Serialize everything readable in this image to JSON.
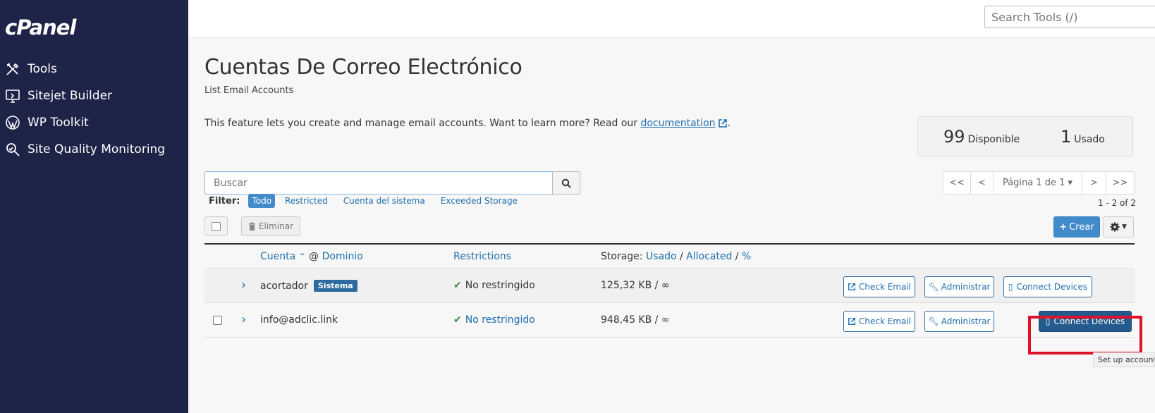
{
  "sidebar": {
    "logo": "cPanel",
    "items": [
      {
        "label": "Tools",
        "icon": "tools-icon"
      },
      {
        "label": "Sitejet Builder",
        "icon": "monitor-icon"
      },
      {
        "label": "WP Toolkit",
        "icon": "wordpress-icon"
      },
      {
        "label": "Site Quality Monitoring",
        "icon": "magnifier-icon"
      }
    ]
  },
  "topbar": {
    "search_placeholder": "Search Tools (/)"
  },
  "page": {
    "title": "Cuentas De Correo Electrónico",
    "subtitle": "List Email Accounts",
    "description": "This feature lets you create and manage email accounts. Want to learn more? Read our ",
    "doc_link": "documentation",
    "description_end": "."
  },
  "stats": {
    "available_num": "99",
    "available_label": "Disponible",
    "used_num": "1",
    "used_label": "Usado"
  },
  "search": {
    "placeholder": "Buscar"
  },
  "pager": {
    "first": "<<",
    "prev": "<",
    "page": "Página 1 de 1",
    "next": ">",
    "last": ">>",
    "count": "1 - 2 of 2"
  },
  "filters": {
    "label": "Filter:",
    "items": [
      "Todo",
      "Restricted",
      "Cuenta del sistema",
      "Exceeded Storage"
    ]
  },
  "toolbar": {
    "delete": "Eliminar",
    "create": "Crear"
  },
  "table": {
    "headers": {
      "account": "Cuenta",
      "at": "@",
      "domain": "Dominio",
      "restrictions": "Restrictions",
      "storage_prefix": "Storage:",
      "used": "Usado",
      "allocated": "Allocated",
      "percent": "%",
      "sep": "/"
    },
    "rows": [
      {
        "account": "acortador",
        "badge": "Sistema",
        "restriction": "No restringido",
        "storage": "125,32 KB / ∞",
        "check_email": "Check Email",
        "manage": "Administrar",
        "connect": "Connect Devices"
      },
      {
        "account": "info@adclic.link",
        "badge": "",
        "restriction": "No restringido",
        "storage": "948,45 KB / ∞",
        "check_email": "Check Email",
        "manage": "Administrar",
        "connect": "Connect Devices"
      }
    ]
  },
  "tooltip": "Set up account",
  "colors": {
    "sidebar": "#1e2348",
    "primary": "#428bca",
    "highlight": "#e0112b"
  }
}
